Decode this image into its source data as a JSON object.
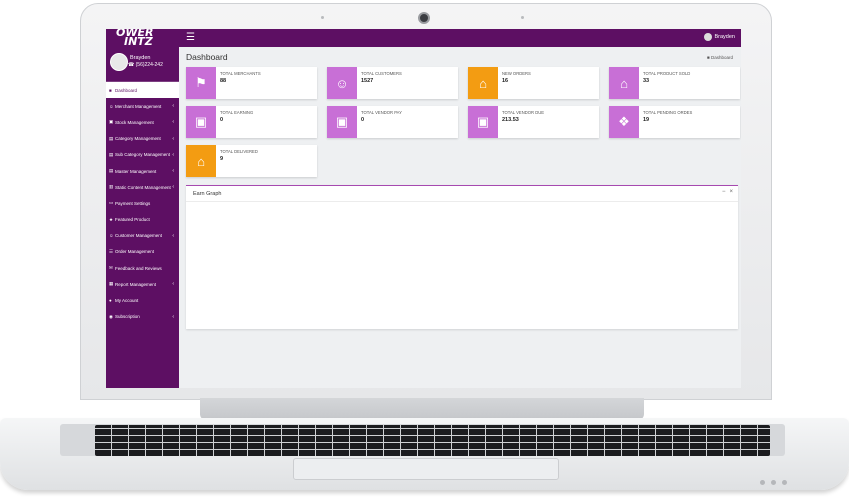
{
  "brand": {
    "logo_line1": "OWER",
    "logo_line2": "INTZ"
  },
  "topbar": {
    "menu_icon": "bars-icon",
    "user_name": "Brayden"
  },
  "profile": {
    "name": "Brayden",
    "phone": "(56)224-242"
  },
  "colors": {
    "primary": "#5d0f63",
    "violet": "#c86fd6",
    "orange": "#f39c12"
  },
  "sidebar": {
    "items": [
      {
        "label": "Dashboard",
        "icon": "dashboard-icon",
        "caret": false
      },
      {
        "label": "Merchant Management",
        "icon": "users-icon",
        "caret": true
      },
      {
        "label": "Stock Management",
        "icon": "stock-icon",
        "caret": true
      },
      {
        "label": "Category Management",
        "icon": "folder-icon",
        "caret": true
      },
      {
        "label": "Sub Category Management",
        "icon": "folder-icon",
        "caret": true
      },
      {
        "label": "Master Management",
        "icon": "folder-icon",
        "caret": true
      },
      {
        "label": "Static Content Management",
        "icon": "file-icon",
        "caret": true
      },
      {
        "label": "Payment Settings",
        "icon": "card-icon",
        "caret": false
      },
      {
        "label": "Featured Product",
        "icon": "star-icon",
        "caret": false
      },
      {
        "label": "Customer Management",
        "icon": "user-icon",
        "caret": true
      },
      {
        "label": "Order Management",
        "icon": "order-icon",
        "caret": false
      },
      {
        "label": "Feedback and Reviews",
        "icon": "comment-icon",
        "caret": false
      },
      {
        "label": "Report Management",
        "icon": "report-icon",
        "caret": true
      },
      {
        "label": "My Account",
        "icon": "account-icon",
        "caret": false
      },
      {
        "label": "Subscription",
        "icon": "subscription-icon",
        "caret": true
      }
    ]
  },
  "page": {
    "title": "Dashboard",
    "breadcrumb": "Dashboard"
  },
  "cards": [
    {
      "label": "TOTAL MERCHANTS",
      "value": "88",
      "icon": "bookmark-icon",
      "color": "#c86fd6"
    },
    {
      "label": "TOTAL CUSTOMERS",
      "value": "1527",
      "icon": "user-icon",
      "color": "#c86fd6"
    },
    {
      "label": "NEW ORDERS",
      "value": "16",
      "icon": "cart-icon",
      "color": "#f39c12"
    },
    {
      "label": "TOTAL PRODUCT SOLD",
      "value": "33",
      "icon": "cart-icon",
      "color": "#c86fd6"
    },
    {
      "label": "TOTAL EARNING",
      "value": "0",
      "icon": "money-icon",
      "color": "#c86fd6"
    },
    {
      "label": "TOTAL VENDOR PAY",
      "value": "0",
      "icon": "money-icon",
      "color": "#c86fd6"
    },
    {
      "label": "TOTAL VENDOR DUE",
      "value": "213.53",
      "icon": "money-icon",
      "color": "#c86fd6"
    },
    {
      "label": "TOTAL PENDING ORDES",
      "value": "19",
      "icon": "gift-icon",
      "color": "#c86fd6"
    },
    {
      "label": "TOTAL DELIVERED",
      "value": "9",
      "icon": "cart-icon",
      "color": "#f39c12"
    }
  ],
  "graph": {
    "title": "Earn Graph",
    "collapse_icon": "minus-icon",
    "close_icon": "close-icon"
  }
}
